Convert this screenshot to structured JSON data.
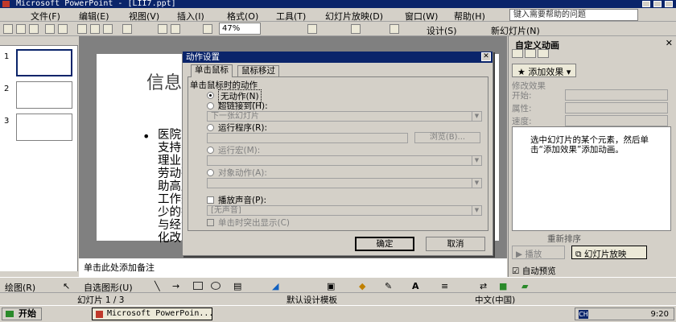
{
  "window": {
    "title": "Microsoft PowerPoint - [LII7.ppt]"
  },
  "menu": {
    "items": [
      "文件(F)",
      "编辑(E)",
      "视图(V)",
      "插入(I)",
      "格式(O)",
      "工具(T)",
      "幻灯片放映(D)",
      "窗口(W)",
      "帮助(H)"
    ],
    "help_placeholder": "键入需要帮助的问题"
  },
  "toolbar": {
    "zoom": "47%",
    "design_label": "设计(S)",
    "new_slide_label": "新幻灯片(N)"
  },
  "outline": {
    "slide_numbers": [
      "1",
      "2",
      "3"
    ]
  },
  "slide": {
    "title": "信息",
    "bullet": "•",
    "body_lines": [
      "医院管",
      "支持医",
      "理业务",
      "劳动强",
      "助高层",
      "工作效",
      "少的技",
      "与经济",
      "化改革"
    ]
  },
  "notes": {
    "placeholder": "单击此处添加备注"
  },
  "taskpane": {
    "title": "自定义动画",
    "add_effect": "添加效果",
    "modify_header": "修改效果",
    "labels": [
      "开始:",
      "属性:",
      "速度:"
    ],
    "hint": "选中幻灯片的某个元素，然后单击“添加效果”添加动画。",
    "reorder": "重新排序",
    "play": "播放",
    "slideshow": "幻灯片放映",
    "auto_preview": "自动预览"
  },
  "dialog": {
    "title": "动作设置",
    "tabs": [
      "单击鼠标",
      "鼠标移过"
    ],
    "group_label": "单击鼠标时的动作",
    "options": {
      "none": "无动作(N)",
      "hyperlink": "超链接到(H):",
      "run": "运行程序(R):",
      "macro": "运行宏(M):",
      "object": "对象动作(A):"
    },
    "hyperlink_value": "下一张幻灯片",
    "browse": "浏览(B)...",
    "play_sound": "播放声音(P):",
    "sound_value": "[无声音]",
    "highlight": "单击时突出显示(C)",
    "ok": "确定",
    "cancel": "取消"
  },
  "drawbar": {
    "draw_label": "绘图(R)",
    "autoshape_label": "自选图形(U)"
  },
  "status": {
    "slide": "幻灯片 1 / 3",
    "template": "默认设计模板",
    "language": "中文(中国)"
  },
  "taskbar": {
    "start": "开始",
    "app": "Microsoft PowerPoin...",
    "ime": "CH",
    "clock": "9:20"
  }
}
